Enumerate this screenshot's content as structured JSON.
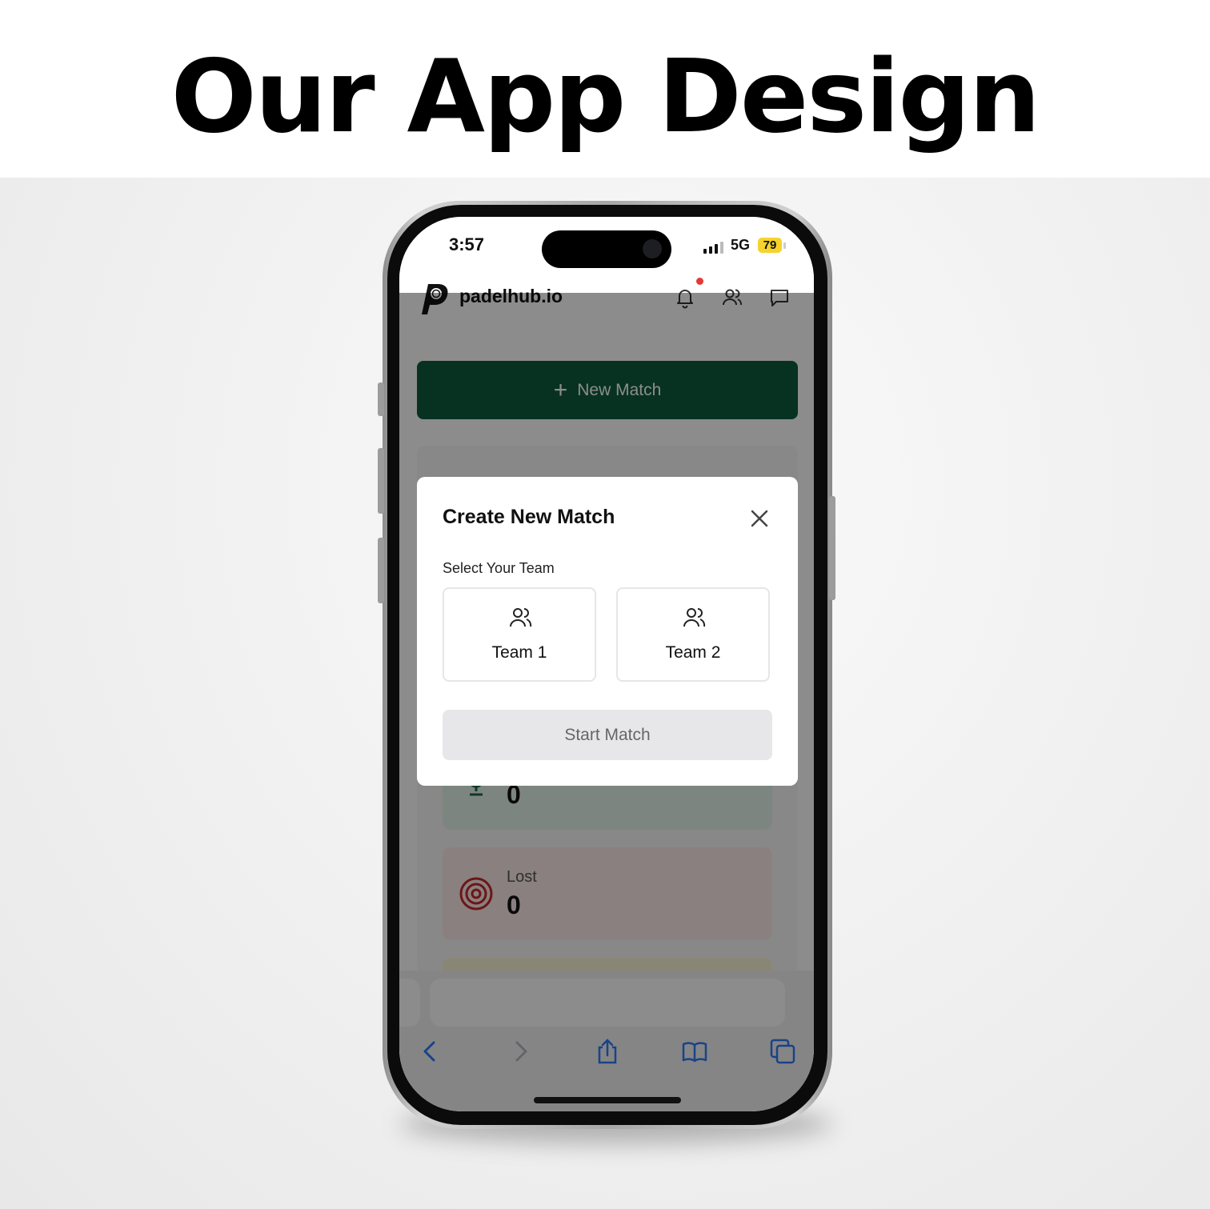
{
  "headline": "Our App Design",
  "status_bar": {
    "time": "3:57",
    "network": "5G",
    "battery": "79"
  },
  "app": {
    "brand": "padelhub.io",
    "new_match_label": "New Match",
    "stats": {
      "won_value": "0",
      "lost_label": "Lost",
      "lost_value": "0"
    }
  },
  "modal": {
    "title": "Create New Match",
    "select_label": "Select Your Team",
    "teams": [
      {
        "label": "Team 1"
      },
      {
        "label": "Team 2"
      }
    ],
    "start_label": "Start Match"
  },
  "icons": {
    "header": [
      "bell-icon",
      "users-icon",
      "message-icon"
    ],
    "safari": [
      "back-icon",
      "forward-icon",
      "share-icon",
      "bookmarks-icon",
      "tabs-icon"
    ]
  },
  "colors": {
    "primary": "#0d5c3c",
    "notification": "#e53935",
    "battery": "#f6d32d",
    "lost": "#c62828",
    "won": "#1a6b45"
  }
}
